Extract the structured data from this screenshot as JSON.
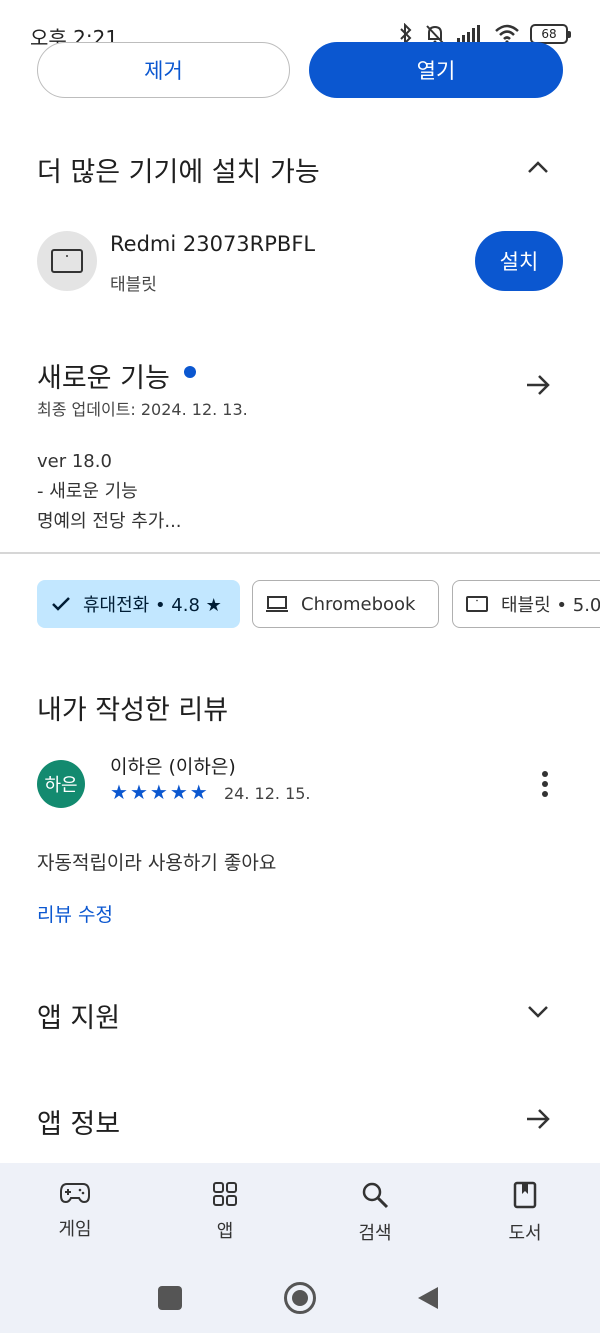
{
  "status_bar": {
    "time": "오후 2:21",
    "battery": "68"
  },
  "actions": {
    "remove_label": "제거",
    "open_label": "열기"
  },
  "more_devices": {
    "title": "더 많은 기기에 설치 가능",
    "device_name": "Redmi 23073RPBFL",
    "device_type": "태블릿",
    "install_label": "설치"
  },
  "whats_new": {
    "title": "새로운 기능",
    "last_updated": "최종 업데이트: 2024. 12. 13.",
    "line1": "ver 18.0",
    "line2": "- 새로운 기능",
    "line3": "명예의 전당 추가..."
  },
  "device_chips": [
    {
      "label": "휴대전화 • 4.8 ★",
      "selected": true
    },
    {
      "label": "Chromebook",
      "selected": false
    },
    {
      "label": "태블릿 • 5.0",
      "selected": false
    }
  ],
  "my_review": {
    "title": "내가 작성한 리뷰",
    "avatar_text": "하은",
    "author": "이하은 (이하은)",
    "rating": 5,
    "date": "24. 12. 15.",
    "text": "자동적립이라 사용하기 좋아요",
    "edit_label": "리뷰 수정"
  },
  "app_support": {
    "title": "앱 지원"
  },
  "app_info": {
    "title": "앱 정보"
  },
  "bottom_nav": {
    "items": [
      {
        "label": "게임",
        "icon": "gamepad-icon"
      },
      {
        "label": "앱",
        "icon": "apps-grid-icon"
      },
      {
        "label": "검색",
        "icon": "search-icon"
      },
      {
        "label": "도서",
        "icon": "bookmark-icon"
      }
    ]
  },
  "colors": {
    "accent": "#0b57d0",
    "chip_selected": "#c2e7ff",
    "avatar": "#138a6f",
    "nav_bg": "#eef1f8"
  }
}
